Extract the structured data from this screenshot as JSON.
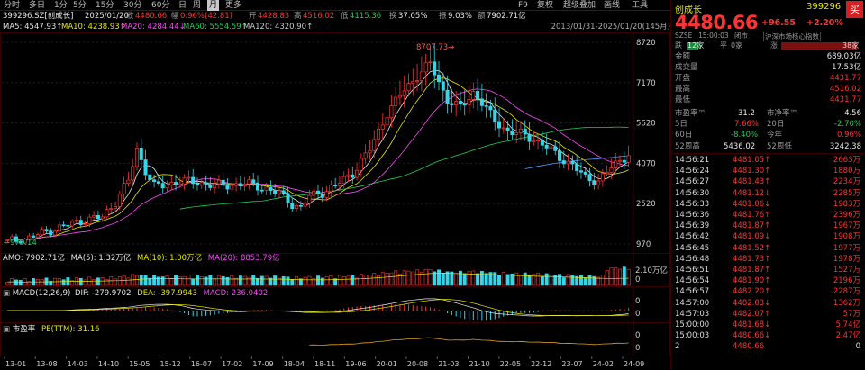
{
  "toolbar": {
    "periods": [
      "分时",
      "多日",
      "1分",
      "5分",
      "15分",
      "30分",
      "60分",
      "日",
      "周",
      "月",
      "更多"
    ],
    "active_period": "月",
    "right_items": [
      "F9",
      "复权",
      "超级叠加",
      "画线",
      "工具"
    ]
  },
  "info": {
    "code_name": "399296.SZ[创成长]",
    "date": "2025/01/20",
    "close_label": "收",
    "close": "4480.66",
    "change_label": "幅",
    "change": "0.96%(42.81)",
    "open_label": "开",
    "open": "4428.83",
    "high_label": "高",
    "high": "4516.02",
    "low_label": "低",
    "low": "4115.36",
    "turnover_label": "换",
    "turnover": "37.05%",
    "amp_label": "振",
    "amp": "9.03%",
    "amount_label": "额",
    "amount": "7902.71亿"
  },
  "ma": {
    "ma5": "MA5: 4547.93↑",
    "ma10": "MA10: 4238.93↑",
    "ma20": "MA20: 4284.44↓",
    "ma60": "MA60: 5554.59↑",
    "ma120": "MA120: 4320.90↑",
    "range": "2013/01/31-2025/01/20(145月)"
  },
  "colors": {
    "up": "#ff3333",
    "down": "#35d6e8",
    "ma5": "#e8e8e8",
    "ma10": "#e8e800",
    "ma20": "#ff44ff",
    "ma60": "#22cc55",
    "ma120": "#4aa0ff"
  },
  "main_chart": {
    "y_labels": [
      "8720",
      "7170",
      "5620",
      "4070",
      "2520",
      "970"
    ],
    "high_marker": "8707.73",
    "low_marker": "970.14"
  },
  "x_labels": [
    "13-01",
    "13-08",
    "14-03",
    "14-10",
    "15-05",
    "15-12",
    "16-07",
    "17-02",
    "17-09",
    "18-04",
    "18-11",
    "19-06",
    "20-01",
    "20-08",
    "21-03",
    "21-10",
    "22-05",
    "22-12",
    "23-07",
    "24-02",
    "24-09"
  ],
  "amo": {
    "text": "AMO: 7902.71亿",
    "ma5": "MA(5): 1.32万亿",
    "ma10": "MA(10): 1.00万亿",
    "ma20": "MA(20): 8853.79亿",
    "y_top": "2.10万亿",
    "y_bottom": "0"
  },
  "macd": {
    "label": "MACD(12,26,9)",
    "dif": "DIF: -279.9702",
    "dea": "DEA: -397.9943",
    "macd": "MACD: 236.0402",
    "y_top": "0",
    "y_bottom": "0"
  },
  "pe": {
    "label": "市盈率",
    "ttm": "PE(TTM): 31.16",
    "y_top": "0",
    "y_bottom": "0"
  },
  "quote": {
    "name": "创成长",
    "code": "399296",
    "buy_button": "买",
    "price": "4480.66",
    "change": "+96.55",
    "change_pct": "+2.20%",
    "exchange": "SZSE",
    "time": "15:00:03",
    "status": "闭市",
    "index_link": "沪深市场核心指数",
    "fall_label": "跌",
    "fall_count": "12家",
    "flat_label": "平",
    "flat_count": "0家",
    "rise_label": "涨",
    "rise_count": "38家",
    "amount_label": "金额",
    "amount": "689.03亿",
    "volume_label": "成交量",
    "volume": "17.53亿",
    "open_label": "开盘",
    "open": "4431.77",
    "high_label": "最高",
    "high": "4516.02",
    "low_label": "最低",
    "low": "4431.77",
    "pe_label": "市盈率™",
    "pe": "31.2",
    "pb_label": "市净率™",
    "pb": "4.56",
    "d5_label": "5日",
    "d5": "7.66%",
    "d20_label": "20日",
    "d20": "-2.70%",
    "d60_label": "60日",
    "d60": "-8.40%",
    "ytd_label": "今年",
    "ytd": "0.96%",
    "h52_label": "52周高",
    "h52": "5436.02",
    "l52_label": "52周低",
    "l52": "3242.38"
  },
  "ticks": [
    {
      "time": "14:56:21",
      "price": "4481.05↑",
      "vol": "2663万"
    },
    {
      "time": "14:56:24",
      "price": "4481.30↑",
      "vol": "1880万"
    },
    {
      "time": "14:56:27",
      "price": "4481.43↑",
      "vol": "2234万"
    },
    {
      "time": "14:56:30",
      "price": "4481.12↓",
      "vol": "2285万"
    },
    {
      "time": "14:56:33",
      "price": "4481.06↓",
      "vol": "1983万"
    },
    {
      "time": "14:56:36",
      "price": "4481.76↑",
      "vol": "2396万"
    },
    {
      "time": "14:56:39",
      "price": "4481.87↑",
      "vol": "1967万"
    },
    {
      "time": "14:56:42",
      "price": "4481.09↓",
      "vol": "1908万"
    },
    {
      "time": "14:56:45",
      "price": "4481.52↑",
      "vol": "1977万"
    },
    {
      "time": "14:56:48",
      "price": "4481.73↑",
      "vol": "1978万"
    },
    {
      "time": "14:56:51",
      "price": "4481.87↑",
      "vol": "1527万"
    },
    {
      "time": "14:56:54",
      "price": "4481.90↑",
      "vol": "2196万"
    },
    {
      "time": "14:56:57",
      "price": "4482.20↑",
      "vol": "2287万"
    },
    {
      "time": "14:57:00",
      "price": "4482.03↓",
      "vol": "1362万"
    },
    {
      "time": "14:57:03",
      "price": "4482.07↑",
      "vol": "57万"
    },
    {
      "time": "15:00:00",
      "price": "4481.68↓",
      "vol": "5.74亿"
    },
    {
      "time": "15:00:03",
      "price": "4480.66↓",
      "vol": "2.47亿"
    },
    {
      "time": "2",
      "price": "4480.66",
      "vol": "0"
    }
  ]
}
